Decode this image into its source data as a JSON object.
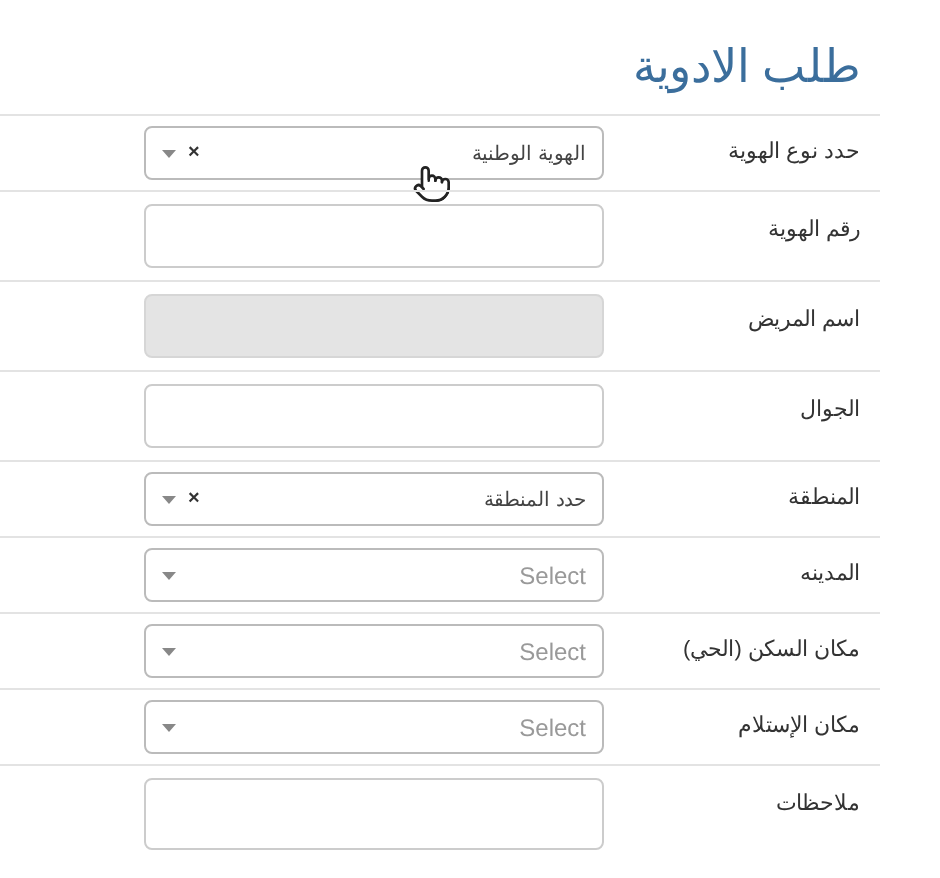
{
  "title": "طلب الادوية",
  "fields": [
    {
      "label": "حدد نوع الهوية",
      "kind": "select",
      "value": "الهوية الوطنية",
      "clear_symbol": "×"
    },
    {
      "label": "رقم الهوية",
      "kind": "text",
      "disabled": false
    },
    {
      "label": "اسم المريض",
      "kind": "text",
      "disabled": true
    },
    {
      "label": "الجوال",
      "kind": "text",
      "disabled": false
    },
    {
      "label": "المنطقة",
      "kind": "select",
      "value": "حدد المنطقة",
      "clear_symbol": "×"
    },
    {
      "label": "المدينه",
      "kind": "select",
      "placeholder": "Select"
    },
    {
      "label": "مكان السكن (الحي)",
      "kind": "select",
      "placeholder": "Select"
    },
    {
      "label": "مكان الإستلام",
      "kind": "select",
      "placeholder": "Select"
    },
    {
      "label": "ملاحظات",
      "kind": "textarea"
    }
  ]
}
